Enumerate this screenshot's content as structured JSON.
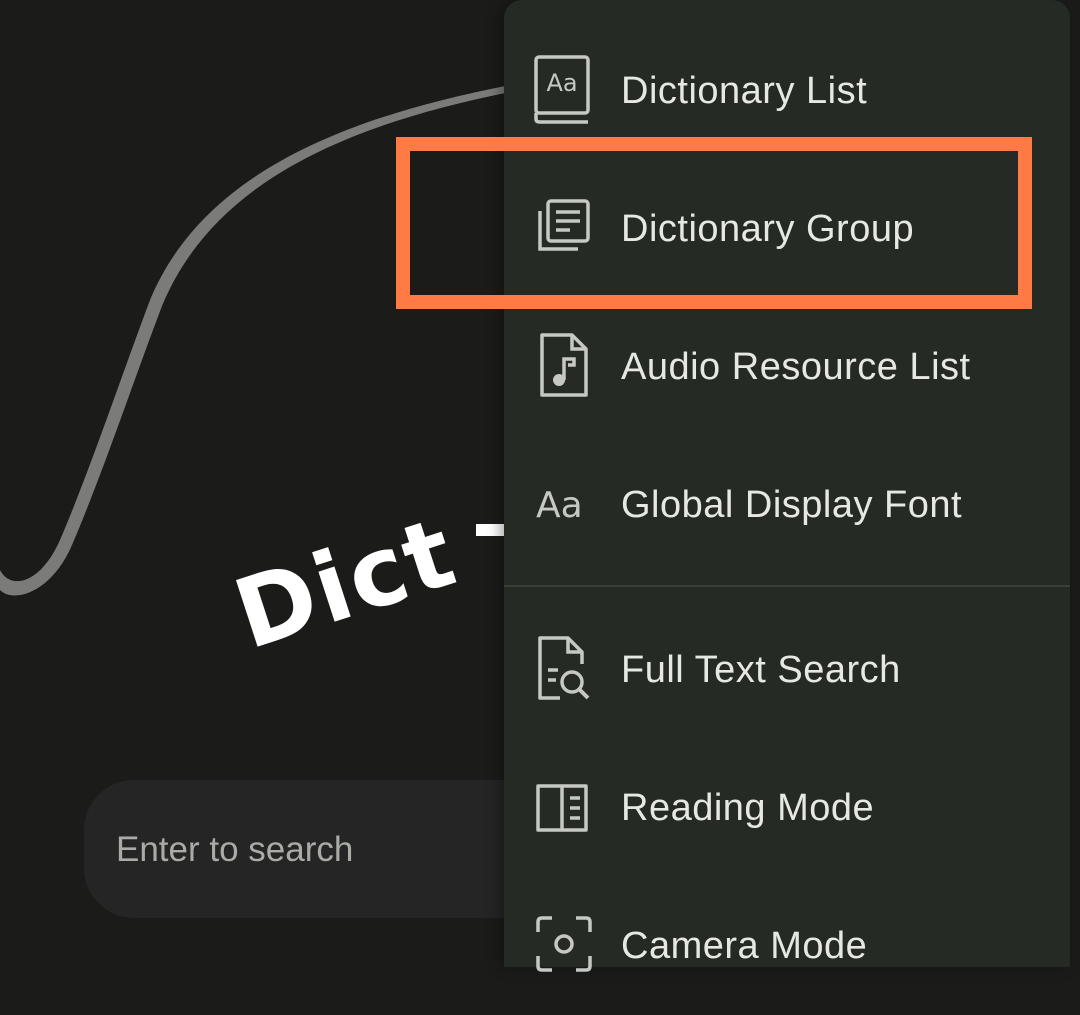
{
  "app": {
    "logo_text": "Dict"
  },
  "search": {
    "placeholder": "Enter to search"
  },
  "menu": {
    "items": [
      {
        "label": "Dictionary List",
        "icon": "book-aa-icon"
      },
      {
        "label": "Dictionary Group",
        "icon": "stacked-documents-icon",
        "highlighted": true
      },
      {
        "label": "Audio Resource List",
        "icon": "audio-file-icon"
      },
      {
        "label": "Global Display Font",
        "icon": "font-aa-icon"
      },
      {
        "label": "Full Text Search",
        "icon": "document-search-icon"
      },
      {
        "label": "Reading Mode",
        "icon": "open-book-icon"
      },
      {
        "label": "Camera Mode",
        "icon": "camera-scan-icon"
      }
    ],
    "icon_glyphs": {
      "aa": "Aa"
    }
  },
  "colors": {
    "background": "#1b1c1a",
    "menu_background": "#252a24",
    "highlight_border": "#ff7a45",
    "text_primary": "#e6e9e3",
    "icon": "#c6c9c3"
  }
}
